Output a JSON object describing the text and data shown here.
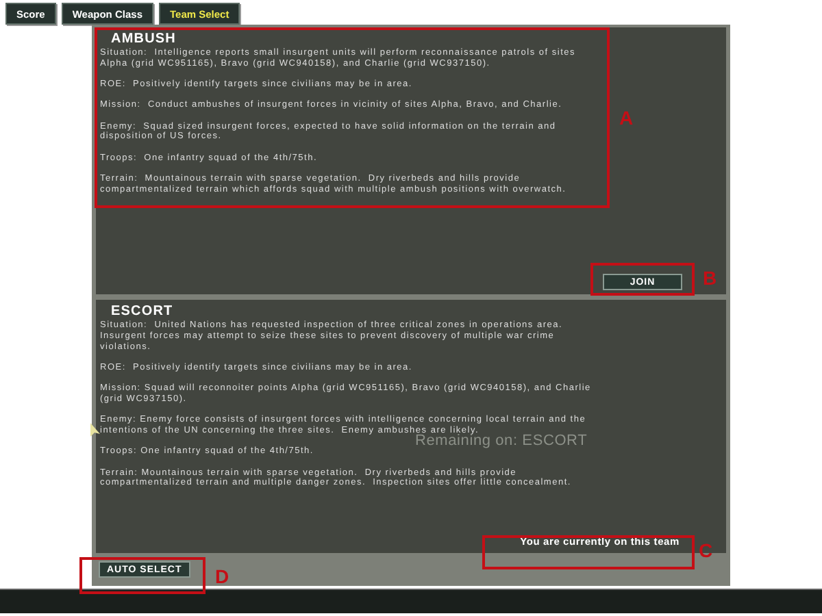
{
  "tabs": [
    {
      "label": "Score",
      "selected": false
    },
    {
      "label": "Weapon Class",
      "selected": false
    },
    {
      "label": "Team Select",
      "selected": true
    }
  ],
  "missions": [
    {
      "title": "AMBUSH",
      "paragraphs": [
        "Situation:  Intelligence reports small insurgent units will perform reconnaissance patrols of sites Alpha (grid WC951165), Bravo (grid WC940158), and Charlie (grid WC937150).",
        "ROE:  Positively identify targets since civilians may be in area.",
        "Mission:  Conduct ambushes of insurgent forces in vicinity of sites Alpha, Bravo, and Charlie.",
        "Enemy:  Squad sized insurgent forces, expected to have solid information on the terrain and disposition of US forces.",
        "Troops:  One infantry squad of the 4th/75th.",
        "Terrain:  Mountainous terrain with sparse vegetation.  Dry riverbeds and hills provide compartmentalized terrain which affords squad with multiple ambush positions with overwatch."
      ],
      "action": {
        "kind": "button",
        "label": "JOIN"
      }
    },
    {
      "title": "ESCORT",
      "paragraphs": [
        "Situation:  United Nations has requested inspection of three critical zones in operations area. Insurgent forces may attempt to seize these sites to prevent discovery of multiple war crime violations.",
        "ROE:  Positively identify targets since civilians may be in area.",
        "Mission: Squad will reconnoiter points Alpha (grid WC951165), Bravo (grid WC940158), and Charlie (grid WC937150).",
        "Enemy: Enemy force consists of insurgent forces with intelligence concerning local terrain and the intentions of the UN concerning the three sites.  Enemy ambushes are likely.",
        "Troops: One infantry squad of the 4th/75th.",
        "Terrain: Mountainous terrain with sparse vegetation.  Dry riverbeds and hills provide compartmentalized terrain and multiple danger zones.  Inspection sites offer little concealment."
      ],
      "action": {
        "kind": "status",
        "label": "You are currently on this team"
      }
    }
  ],
  "tooltip": "Remaining on: ESCORT",
  "auto_select": "AUTO SELECT",
  "annotations": [
    {
      "letter": "A"
    },
    {
      "letter": "B"
    },
    {
      "letter": "C"
    },
    {
      "letter": "D"
    }
  ]
}
